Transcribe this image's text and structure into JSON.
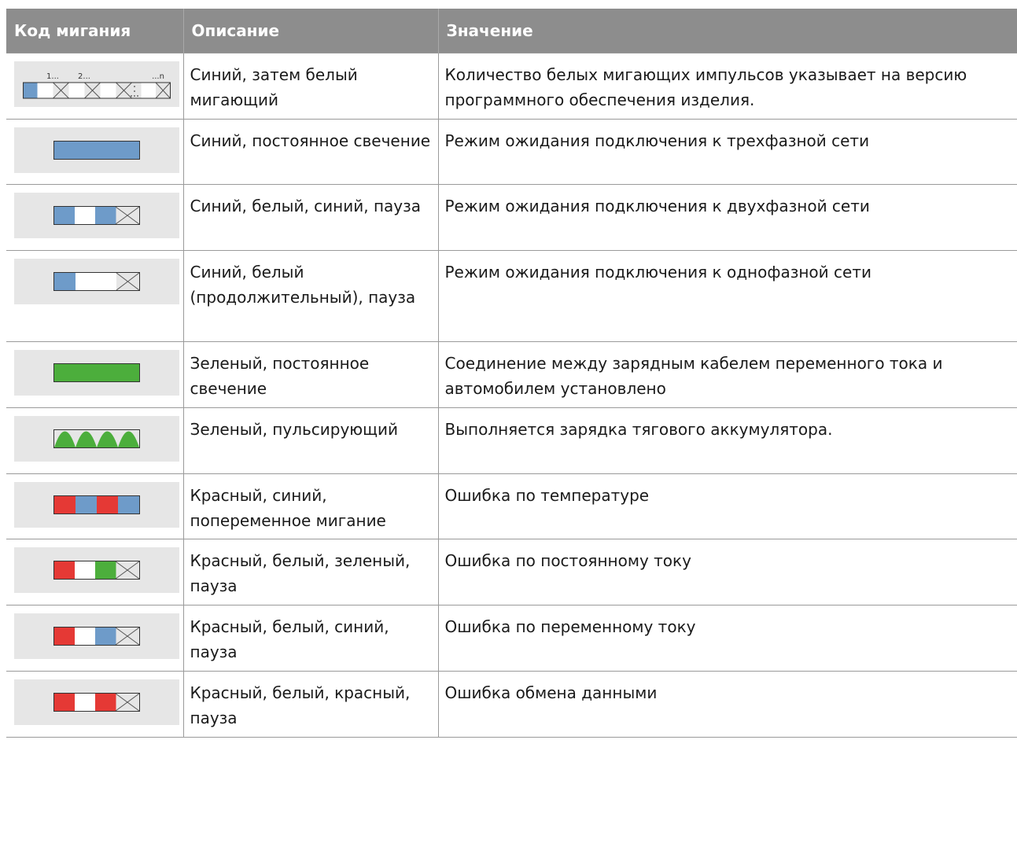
{
  "table": {
    "headers": {
      "code": "Код мигания",
      "description": "Описание",
      "meaning": "Значение"
    },
    "rows": [
      {
        "pattern": "blue-then-white-count",
        "labels": [
          "1...",
          "2...",
          "...n"
        ],
        "description": "Синий, затем белый мигающий",
        "meaning": "Количество белых мигающих импульсов указывает на версию программного обеспечения изделия."
      },
      {
        "pattern": "blue-steady",
        "description": "Синий, постоянное свечение",
        "meaning": "Режим ожидания подключения к трехфазной сети"
      },
      {
        "pattern": "blue-white-blue-pause",
        "description": "Синий, белый, синий, пауза",
        "meaning": "Режим ожидания подключения к двухфазной сети"
      },
      {
        "pattern": "blue-white-long-pause",
        "description": "Синий, белый (продолжительный), пауза",
        "meaning": "Режим ожидания подключения к однофазной сети"
      },
      {
        "pattern": "green-steady",
        "description": "Зеленый, постоянное свечение",
        "meaning": "Соединение между зарядным кабелем переменного тока и автомобилем установлено"
      },
      {
        "pattern": "green-pulsing",
        "description": "Зеленый, пульсирующий",
        "meaning": "Выполняется зарядка тягового аккумулятора."
      },
      {
        "pattern": "red-blue-alternating",
        "description": "Красный, синий, попеременное мигание",
        "meaning": "Ошибка по температуре"
      },
      {
        "pattern": "red-white-green-pause",
        "description": "Красный, белый, зеленый, пауза",
        "meaning": "Ошибка по постоянному току"
      },
      {
        "pattern": "red-white-blue-pause",
        "description": "Красный, белый, синий, пауза",
        "meaning": "Ошибка по переменному току"
      },
      {
        "pattern": "red-white-red-pause",
        "description": "Красный, белый, красный, пауза",
        "meaning": "Ошибка обмена данными"
      }
    ]
  },
  "colors": {
    "blue": "#6e9bc9",
    "green": "#4cae3c",
    "red": "#e53935",
    "white": "#ffffff",
    "header_bg": "#8d8d8d",
    "code_bg": "#e6e6e6"
  }
}
